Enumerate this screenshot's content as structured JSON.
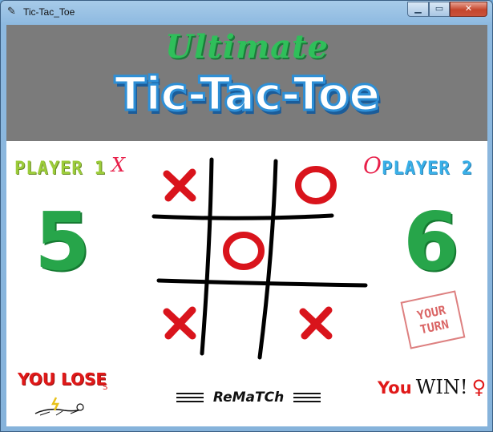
{
  "window": {
    "title": "Tic-Tac_Toe",
    "min_icon": "minimize-icon",
    "max_icon": "maximize-icon",
    "close_icon": "close-icon"
  },
  "header": {
    "title_top": "Ultimate",
    "title_main": "Tic-Tac-Toe"
  },
  "player1": {
    "label": "PLAYER 1",
    "mark": "X",
    "score": "5"
  },
  "player2": {
    "label": "PLAYER 2",
    "mark": "O",
    "score": "6"
  },
  "board": {
    "cells": [
      "X",
      "",
      "O",
      "",
      "O",
      "",
      "X",
      "",
      "X"
    ]
  },
  "turn_stamp": {
    "line1": "YOUR",
    "line2": "TURN"
  },
  "player1_result": {
    "text": "YOU LOSE",
    "sub": "S"
  },
  "player2_result": {
    "you": "You",
    "win": "WIN!",
    "symbol": "♀"
  },
  "rematch": {
    "label": "ReMaTCh"
  },
  "colors": {
    "x": "#d9141c",
    "o": "#d9141c",
    "score": "#27a54a",
    "header_bg": "#7b7b7b",
    "player1": "#9ccc3a",
    "player2": "#3ab0e8"
  }
}
